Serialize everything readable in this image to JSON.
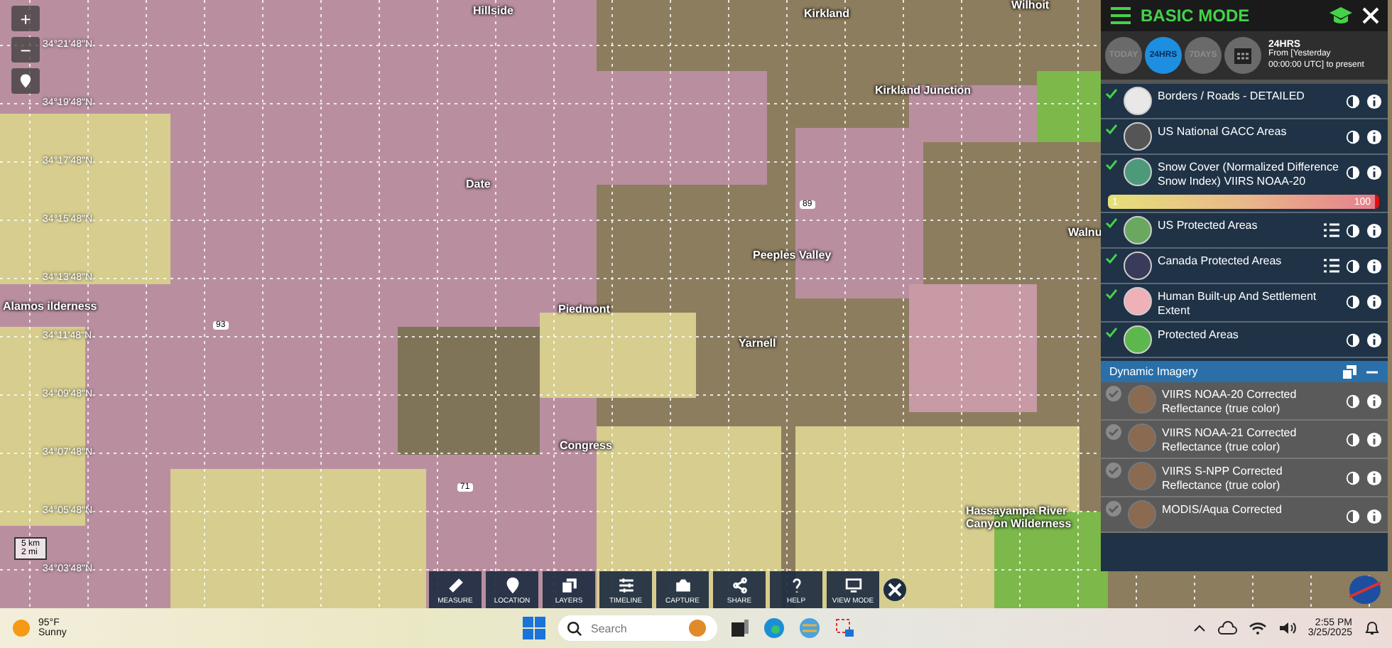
{
  "map": {
    "zoom_in": "+",
    "zoom_out": "−",
    "latitudes": [
      "34°21'48\"N",
      "34°19'48\"N",
      "34°17'48\"N",
      "34°15'48\"N",
      "34°13'48\"N",
      "34°11'48\"N",
      "34°09'48\"N",
      "34°07'48\"N",
      "34°05'48\"N",
      "34°03'48\"N"
    ],
    "places": [
      "Hillside",
      "Kirkland",
      "Wilhoit",
      "Kirkland Junction",
      "Date",
      "Peeples Valley",
      "Piedmont",
      "Yarnell",
      "Congress",
      "Walnu",
      "Hassayampa River Canyon Wilderness",
      "Alamos ilderness"
    ],
    "roads": [
      "89",
      "93",
      "71"
    ],
    "scale": {
      "metric": "5 km",
      "imperial": "2 mi"
    }
  },
  "panel": {
    "title": "BASIC MODE",
    "time_buttons": [
      {
        "label": "TODAY",
        "selected": false
      },
      {
        "label": "24HRS",
        "selected": true
      },
      {
        "label": "7DAYS",
        "selected": false
      }
    ],
    "range_title": "24HRS",
    "range_text": "From [Yesterday 00:00:00 UTC] to present",
    "layers": [
      {
        "name": "Borders / Roads - DETAILED",
        "checked": true,
        "legend": false
      },
      {
        "name": "US National GACC Areas",
        "checked": true,
        "legend": false
      },
      {
        "name": "Snow Cover (Normalized Difference Snow Index) VIIRS NOAA-20",
        "checked": true,
        "legend": false,
        "scale": {
          "min": "1",
          "max": "100"
        }
      },
      {
        "name": "US Protected Areas",
        "checked": true,
        "legend": true
      },
      {
        "name": "Canada Protected Areas",
        "checked": true,
        "legend": true
      },
      {
        "name": "Human Built-up And Settlement Extent",
        "checked": true,
        "legend": false
      },
      {
        "name": "Protected Areas",
        "checked": true,
        "legend": false
      }
    ],
    "dynamic_title": "Dynamic Imagery",
    "dynamic_layers": [
      {
        "name": "VIIRS NOAA-20 Corrected Reflectance (true color)",
        "checked": false
      },
      {
        "name": "VIIRS NOAA-21 Corrected Reflectance (true color)",
        "checked": false
      },
      {
        "name": "VIIRS S-NPP Corrected Reflectance (true color)",
        "checked": false
      },
      {
        "name": "MODIS/Aqua Corrected",
        "checked": false
      }
    ]
  },
  "toolbar": [
    {
      "label": "MEASURE",
      "kind": "ruler"
    },
    {
      "label": "LOCATION",
      "kind": "pin"
    },
    {
      "label": "LAYERS",
      "kind": "layers"
    },
    {
      "label": "TIMELINE",
      "kind": "sliders"
    },
    {
      "label": "CAPTURE",
      "kind": "camera"
    },
    {
      "label": "SHARE",
      "kind": "share"
    },
    {
      "label": "HELP",
      "kind": "help"
    },
    {
      "label": "VIEW MODE",
      "kind": "monitor"
    }
  ],
  "taskbar": {
    "temperature": "95°F",
    "weather": "Sunny",
    "search_placeholder": "Search",
    "time": "2:55 PM",
    "date": "3/25/2025"
  }
}
